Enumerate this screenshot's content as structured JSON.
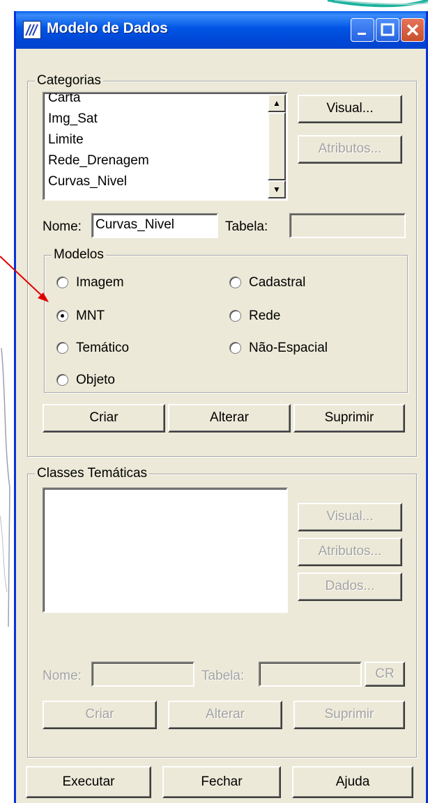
{
  "window": {
    "title": "Modelo de Dados"
  },
  "categorias": {
    "legend": "Categorias",
    "items": [
      "Carta",
      "Img_Sat",
      "Limite",
      "Rede_Drenagem",
      "Curvas_Nivel"
    ],
    "visual_label": "Visual...",
    "atributos_label": "Atributos...",
    "nome_label": "Nome:",
    "nome_value": "Curvas_Nivel",
    "tabela_label": "Tabela:",
    "tabela_value": ""
  },
  "modelos": {
    "legend": "Modelos",
    "options": [
      "Imagem",
      "Cadastral",
      "MNT",
      "Rede",
      "Temático",
      "Não-Espacial",
      "Objeto"
    ],
    "selected": "MNT",
    "criar_label": "Criar",
    "alterar_label": "Alterar",
    "suprimir_label": "Suprimir"
  },
  "classes": {
    "legend": "Classes Temáticas",
    "visual_label": "Visual...",
    "atributos_label": "Atributos...",
    "dados_label": "Dados...",
    "nome_label": "Nome:",
    "tabela_label": "Tabela:",
    "cr_label": "CR",
    "criar_label": "Criar",
    "alterar_label": "Alterar",
    "suprimir_label": "Suprimir"
  },
  "footer": {
    "executar_label": "Executar",
    "fechar_label": "Fechar",
    "ajuda_label": "Ajuda"
  },
  "colors": {
    "titlebar": "#0055E5",
    "dialog": "#ECE9D8",
    "annotation_arrow": "#E00000",
    "teal_shape": "#1BB3A0"
  }
}
